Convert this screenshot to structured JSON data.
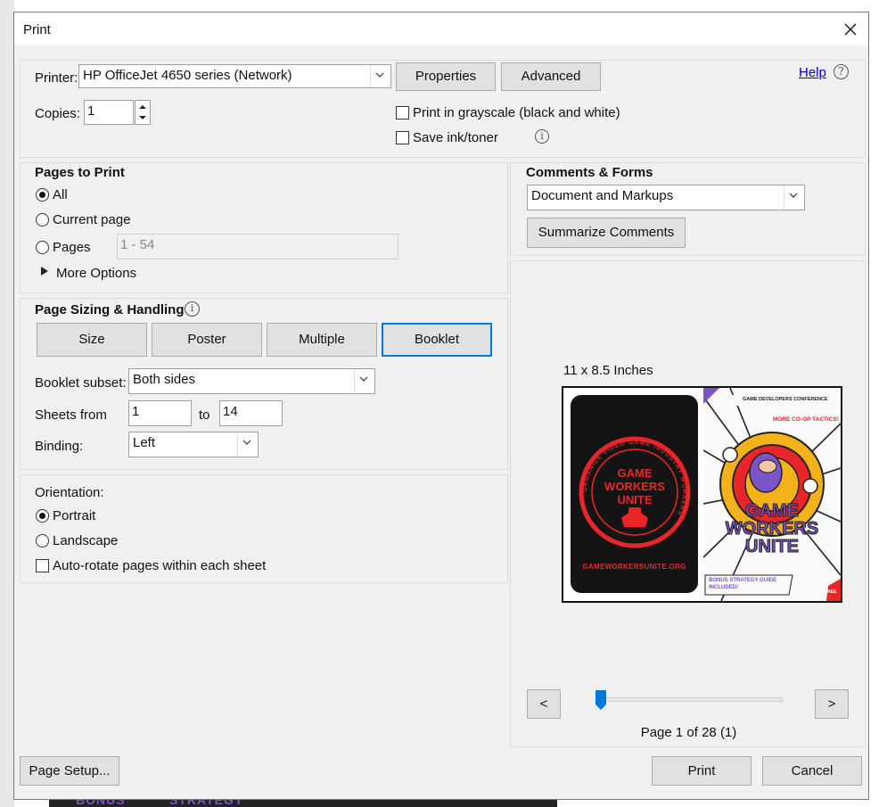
{
  "window": {
    "title": "Print"
  },
  "printer": {
    "label": "Printer:",
    "selected": "HP OfficeJet 4650 series (Network)",
    "properties_label": "Properties",
    "advanced_label": "Advanced",
    "help_label": "Help",
    "copies_label": "Copies:",
    "copies_value": "1",
    "grayscale_label": "Print in grayscale (black and white)",
    "save_ink_label": "Save ink/toner"
  },
  "pages_to_print": {
    "heading": "Pages to Print",
    "all_label": "All",
    "current_label": "Current page",
    "pages_label": "Pages",
    "pages_placeholder": "1 - 54",
    "more_options_label": "More Options"
  },
  "page_sizing": {
    "heading": "Page Sizing & Handling",
    "tabs": [
      "Size",
      "Poster",
      "Multiple",
      "Booklet"
    ],
    "booklet_subset_label": "Booklet subset:",
    "booklet_subset_value": "Both sides",
    "sheets_from_label": "Sheets from",
    "sheets_from_value": "1",
    "sheets_to_label": "to",
    "sheets_to_value": "14",
    "binding_label": "Binding:",
    "binding_value": "Left"
  },
  "orientation": {
    "heading": "Orientation:",
    "portrait_label": "Portrait",
    "landscape_label": "Landscape",
    "autorotate_label": "Auto-rotate pages within each sheet"
  },
  "comments_forms": {
    "heading": "Comments & Forms",
    "selected": "Document and Markups",
    "summarize_label": "Summarize Comments"
  },
  "preview": {
    "paper_size": "11 x 8.5 Inches",
    "left_page_title": "GAME WORKERS UNITE",
    "left_page_ring_text": "ORGANIZE VIDEO GAME INDUSTRY WORKERS",
    "left_page_url": "GAMEWORKERSUNITE.ORG",
    "right_page_header": "GAME DEVELOPERS CONFERENCE",
    "right_page_tag": "MORE CO-OP TACTICS!",
    "right_page_title": "GAME WORKERS UNITE",
    "right_page_footer": "BONUS STRATEGY GUIDE INCLUDED!",
    "right_page_free": "FREE",
    "prev_label": "<",
    "next_label": ">",
    "page_status": "Page 1 of 28 (1)",
    "slider_position": 0
  },
  "footer": {
    "page_setup_label": "Page Setup...",
    "print_label": "Print",
    "cancel_label": "Cancel"
  },
  "colors": {
    "accent": "#0078d7",
    "gwu_red": "#e8262a",
    "gwu_purple": "#7b54c8"
  }
}
